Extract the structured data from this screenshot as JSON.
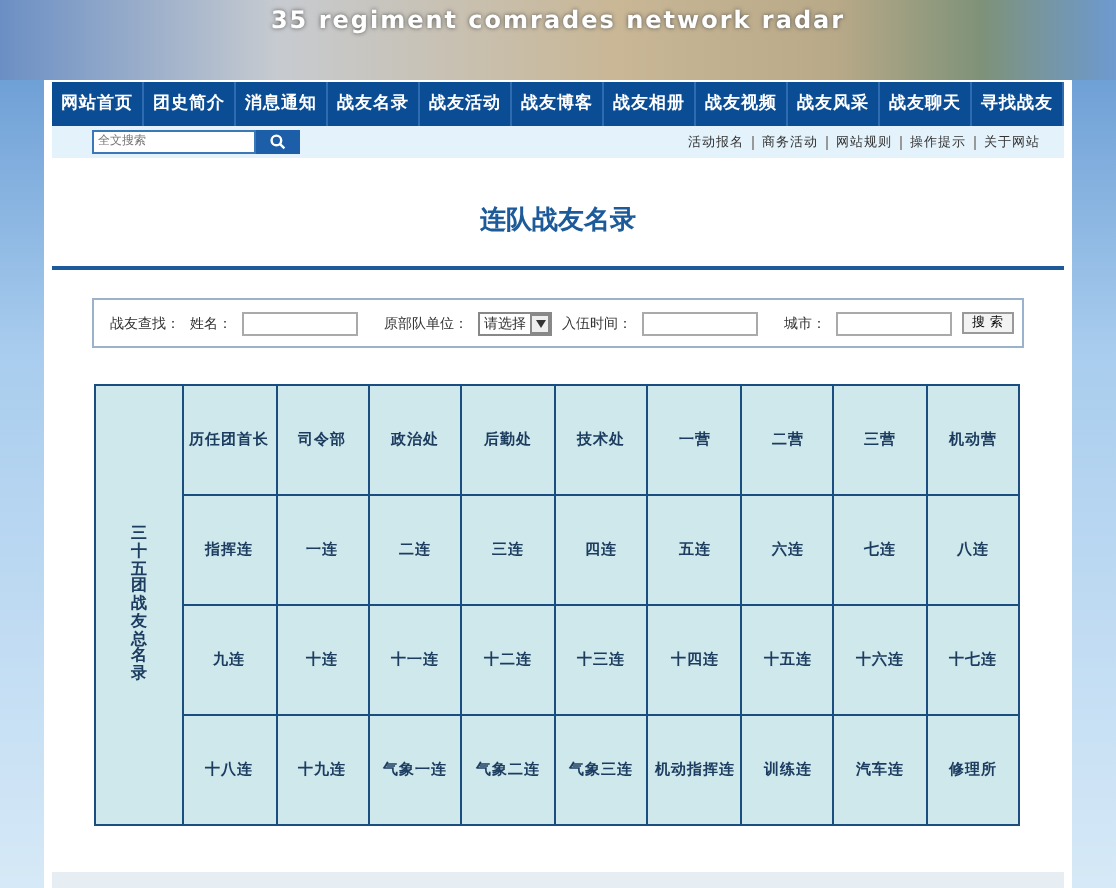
{
  "banner": {
    "title": "35 regiment comrades network radar"
  },
  "nav": [
    {
      "label": "网站首页"
    },
    {
      "label": "团史简介"
    },
    {
      "label": "消息通知"
    },
    {
      "label": "战友名录"
    },
    {
      "label": "战友活动"
    },
    {
      "label": "战友博客"
    },
    {
      "label": "战友相册"
    },
    {
      "label": "战友视频"
    },
    {
      "label": "战友风采"
    },
    {
      "label": "战友聊天"
    },
    {
      "label": "寻找战友"
    }
  ],
  "site_search": {
    "placeholder": "全文搜索"
  },
  "quick_links": [
    "活动报名",
    "商务活动",
    "网站规则",
    "操作提示",
    "关于网站"
  ],
  "page_title": "连队战友名录",
  "finder": {
    "label": "战友查找：",
    "name_label": "姓名：",
    "unit_label": "原部队单位：",
    "unit_value": "请选择",
    "enlist_label": "入伍时间：",
    "city_label": "城市：",
    "button": "搜 索"
  },
  "directory": {
    "side_label": "三十五团战友总名录",
    "rows": [
      [
        "历任团首长",
        "司令部",
        "政治处",
        "后勤处",
        "技术处",
        "一营",
        "二营",
        "三营",
        "机动营"
      ],
      [
        "指挥连",
        "一连",
        "二连",
        "三连",
        "四连",
        "五连",
        "六连",
        "七连",
        "八连"
      ],
      [
        "九连",
        "十连",
        "十一连",
        "十二连",
        "十三连",
        "十四连",
        "十五连",
        "十六连",
        "十七连"
      ],
      [
        "十八连",
        "十九连",
        "气象一连",
        "气象二连",
        "气象三连",
        "机动指挥连",
        "训练连",
        "汽车连",
        "修理所"
      ]
    ]
  }
}
